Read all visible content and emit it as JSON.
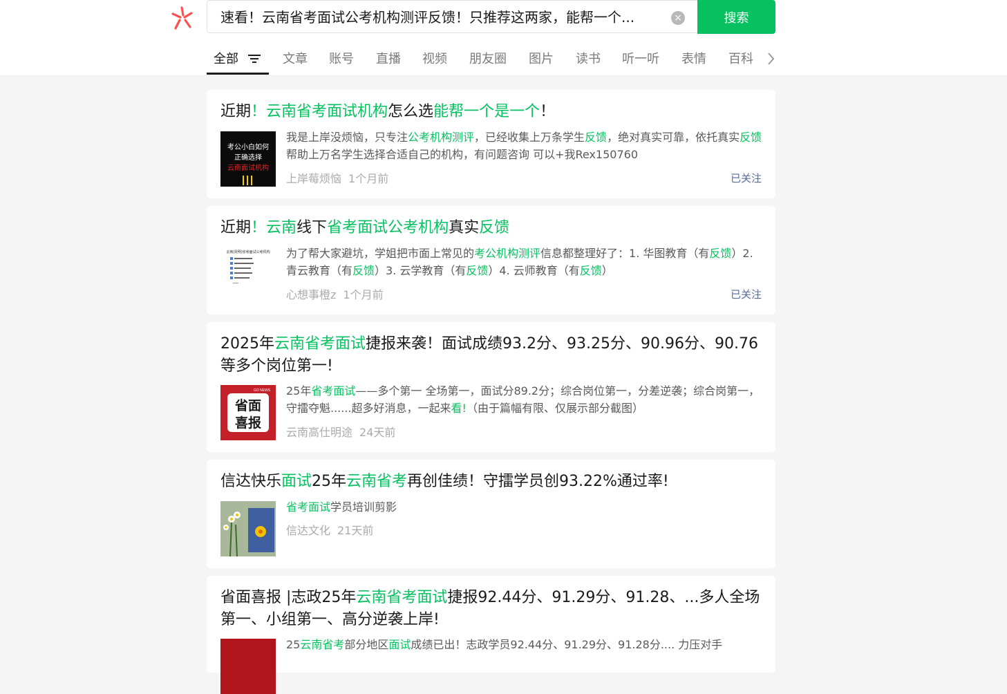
{
  "search": {
    "query": "速看！云南省考面试公考机构测评反馈！只推荐这两家，能帮一个...",
    "clear_label": "×",
    "button_label": "搜索"
  },
  "tabs": [
    "全部",
    "文章",
    "账号",
    "直播",
    "视频",
    "朋友圈",
    "图片",
    "读书",
    "听一听",
    "表情",
    "百科"
  ],
  "colors": {
    "accent": "#07c160",
    "link": "#576b95"
  },
  "results": [
    {
      "title": [
        {
          "t": "近期"
        },
        {
          "t": "！",
          "hl": true
        },
        {
          "t": "云南省考面试机构",
          "hl": true
        },
        {
          "t": "怎么选"
        },
        {
          "t": "能帮一个是一个",
          "hl": true
        },
        {
          "t": "！"
        }
      ],
      "thumb": {
        "lines": [
          "考公小白如何",
          "正确选择",
          "云南面试机构"
        ]
      },
      "desc": [
        {
          "t": "我是上岸没烦恼，只专注"
        },
        {
          "t": "公考机构测评",
          "hl": true
        },
        {
          "t": "，已经收集上万条学生"
        },
        {
          "t": "反馈",
          "hl": true
        },
        {
          "t": "，绝对真实可靠，依托真实"
        },
        {
          "t": "反馈",
          "hl": true
        },
        {
          "t": "帮助上万名学生选择合适自己的机构，有问题咨询 可以+我Rex150760"
        }
      ],
      "source": "上岸莓烦恼",
      "time": "1个月前",
      "follow": "已关注"
    },
    {
      "title": [
        {
          "t": "近期"
        },
        {
          "t": "！",
          "hl": true
        },
        {
          "t": "云南",
          "hl": true
        },
        {
          "t": "线下"
        },
        {
          "t": "省考面试公考机构",
          "hl": true
        },
        {
          "t": "真实"
        },
        {
          "t": "反馈",
          "hl": true
        }
      ],
      "thumb": {
        "lines": [
          "云南(昆明)省考面试公考机构"
        ]
      },
      "desc": [
        {
          "t": "为了帮大家避坑，学姐把市面上常见的"
        },
        {
          "t": "考公机构测评",
          "hl": true
        },
        {
          "t": "信息都整理好了：1. 华图教育（有"
        },
        {
          "t": "反馈",
          "hl": true
        },
        {
          "t": "）2. 青云教育（有"
        },
        {
          "t": "反馈",
          "hl": true
        },
        {
          "t": "）3. 云学教育（有"
        },
        {
          "t": "反馈",
          "hl": true
        },
        {
          "t": "）4. 云师教育（有"
        },
        {
          "t": "反馈",
          "hl": true
        },
        {
          "t": "）"
        }
      ],
      "source": "心想事橙z",
      "time": "1个月前",
      "follow": "已关注"
    },
    {
      "title": [
        {
          "t": "2025年"
        },
        {
          "t": "云南省考面试",
          "hl": true
        },
        {
          "t": "捷报来袭！面试成绩93.2分、93.25分、90.96分、90.76等多个岗位第一!"
        }
      ],
      "thumb": {
        "lines": [
          "省面",
          "喜报",
          "GO NEWS"
        ]
      },
      "desc": [
        {
          "t": "25年"
        },
        {
          "t": "省考面试",
          "hl": true
        },
        {
          "t": "——多个第一 全场第一，面试分89.2分；综合岗位第一，分差逆袭；综合岗第一，守擂夺魁......超多好消息，一起来"
        },
        {
          "t": "看!",
          "hl": true
        },
        {
          "t": "（由于篇幅有限、仅展示部分截图）"
        }
      ],
      "source": "云南高仕明途",
      "time": "24天前"
    },
    {
      "title": [
        {
          "t": "信达快乐"
        },
        {
          "t": "面试",
          "hl": true
        },
        {
          "t": "25年"
        },
        {
          "t": "云南省考",
          "hl": true
        },
        {
          "t": "再创佳绩！守擂学员创93.22%通过率!"
        }
      ],
      "thumb": {
        "lines": []
      },
      "desc": [
        {
          "t": "省考面试",
          "hl": true
        },
        {
          "t": "学员培训剪影"
        }
      ],
      "source": "信达文化",
      "time": "21天前"
    },
    {
      "title": [
        {
          "t": "省面喜报 |志政25年"
        },
        {
          "t": "云南省考面试",
          "hl": true
        },
        {
          "t": "捷报92.44分、91.29分、91.28、...多人全场第一、小组第一、高分逆袭上岸!"
        }
      ],
      "thumb": {
        "lines": []
      },
      "desc": [
        {
          "t": "25"
        },
        {
          "t": "云南省考",
          "hl": true
        },
        {
          "t": "部分地区"
        },
        {
          "t": "面试",
          "hl": true
        },
        {
          "t": "成绩已出！志政学员92.44分、91.29分、91.28分.... 力压对手"
        }
      ]
    }
  ]
}
